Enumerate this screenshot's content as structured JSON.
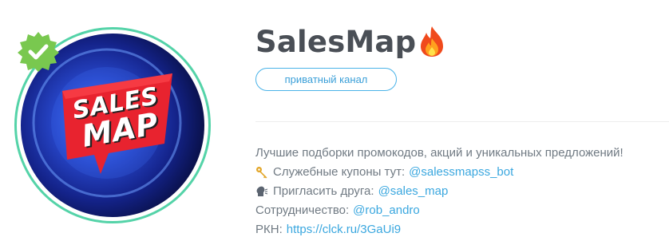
{
  "channel": {
    "title": "SalesMap",
    "title_emoji": "fire-icon",
    "verified": true,
    "privacy_label": "приватный канал"
  },
  "avatar": {
    "logo_line1": "SALES",
    "logo_line2": "MAP"
  },
  "description": {
    "line1": "Лучшие подборки промокодов, акций и уникальных предложений!",
    "line2_icon": "key-icon",
    "line2_text": "Служебные купоны тут:",
    "line2_link": "@salessmapss_bot",
    "line3_icon": "speaking-head-icon",
    "line3_text": "Пригласить друга:",
    "line3_link": "@sales_map",
    "line4_text": "Сотрудничество:",
    "line4_link": "@rob_andro",
    "line5_text": "РКН:",
    "line5_link": "https://clck.ru/3GaUi9"
  },
  "colors": {
    "accent": "#3aa7df",
    "ring": "#54d3a8",
    "badge": "#79c84f",
    "title": "#4a4f56",
    "text": "#707a83"
  }
}
